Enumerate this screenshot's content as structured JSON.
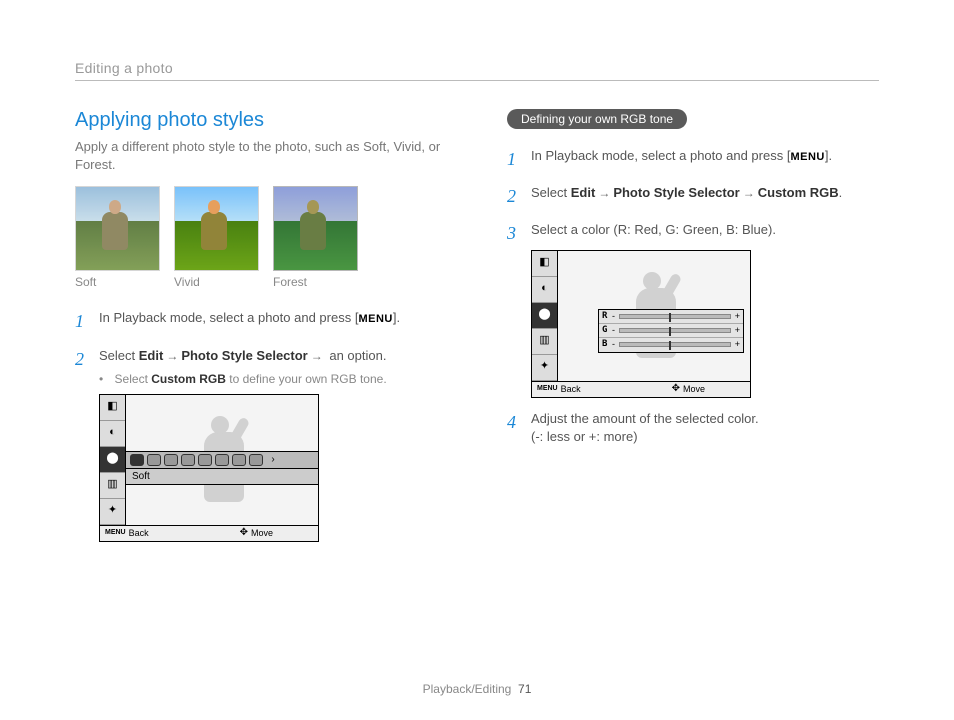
{
  "breadcrumb": "Editing a photo",
  "left": {
    "title": "Applying photo styles",
    "intro": "Apply a different photo style to the photo, such as Soft, Vivid, or Forest.",
    "thumbs": [
      "Soft",
      "Vivid",
      "Forest"
    ],
    "step1_a": "In Playback mode, select a photo and press [",
    "step1_menu": "MENU",
    "step1_b": "].",
    "step2_a": "Select ",
    "step2_edit": "Edit",
    "step2_b": "Photo Style Selector",
    "step2_c": " an option.",
    "step2_sub_a": "Select ",
    "step2_sub_b": "Custom RGB",
    "step2_sub_c": " to define your own RGB tone.",
    "screenshot": {
      "strip_label": "Soft",
      "back": "Back",
      "move": "Move",
      "menu": "MENU"
    }
  },
  "right": {
    "pill": "Defining your own RGB tone",
    "step1_a": "In Playback mode, select a photo and press [",
    "step1_menu": "MENU",
    "step1_b": "].",
    "step2_a": "Select ",
    "step2_edit": "Edit",
    "step2_b": "Photo Style Selector",
    "step2_c": "Custom RGB",
    "step2_d": ".",
    "step3": "Select a color (R: Red, G: Green, B: Blue).",
    "screenshot": {
      "r": "R",
      "g": "G",
      "b": "B",
      "minus": "-",
      "plus": "+",
      "back": "Back",
      "move": "Move",
      "menu": "MENU"
    },
    "step4_a": "Adjust the amount of the selected color.",
    "step4_b": "(-: less or +: more)"
  },
  "footer": {
    "section": "Playback/Editing",
    "page": "71"
  }
}
